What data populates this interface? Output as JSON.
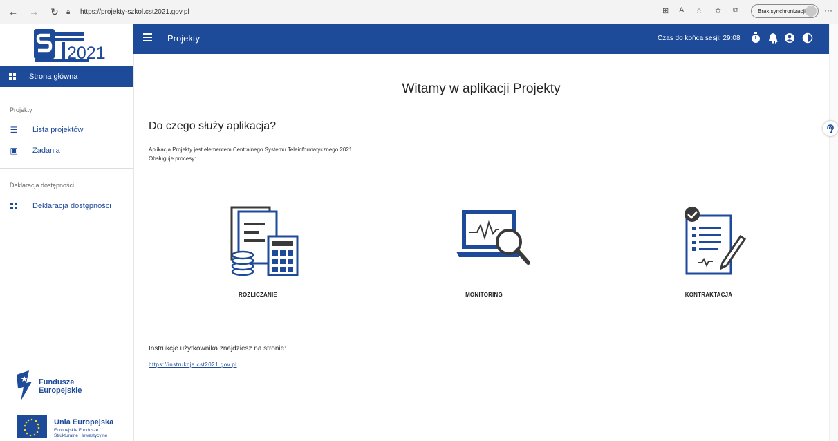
{
  "browser": {
    "url": "https://projekty-szkol.cst2021.gov.pl",
    "sync_label": "Brak synchronizacji"
  },
  "sidebar": {
    "logo_text": "2021",
    "active_item": "Strona główna",
    "sections": [
      {
        "title": "Projekty",
        "items": [
          "Lista projektów",
          "Zadania"
        ]
      },
      {
        "title": "Deklaracja dostępności",
        "items": [
          "Deklaracja dostępności"
        ]
      }
    ],
    "fe_logo": {
      "line1": "Fundusze",
      "line2": "Europejskie"
    },
    "ue_logo": {
      "line1": "Unia Europejska",
      "line2": "Europejskie Fundusze",
      "line3": "Strukturalne i Inwestycyjne"
    }
  },
  "appbar": {
    "title": "Projekty",
    "session_text": "Czas do końca sesji: 29:08"
  },
  "main": {
    "title": "Witamy w aplikacji Projekty",
    "subtitle": "Do czego służy aplikacja?",
    "desc_line1": "Aplikacja Projekty jest elementem Centralnego Systemu Teleinformatycznego 2021.",
    "desc_line2": "Obsługuje procesy:",
    "features": [
      {
        "label": "ROZLICZANIE",
        "icon": "calculator-documents-icon"
      },
      {
        "label": "MONITORING",
        "icon": "laptop-magnifier-icon"
      },
      {
        "label": "KONTRAKTACJA",
        "icon": "checklist-pen-icon"
      }
    ],
    "instructions_text": "Instrukcje użytkownika znajdziesz na stronie:",
    "instructions_link": "https://instrukcje.cst2021.gov.pl"
  },
  "colors": {
    "primary": "#1e4a9a",
    "icon_dark": "#3a3a3a"
  }
}
